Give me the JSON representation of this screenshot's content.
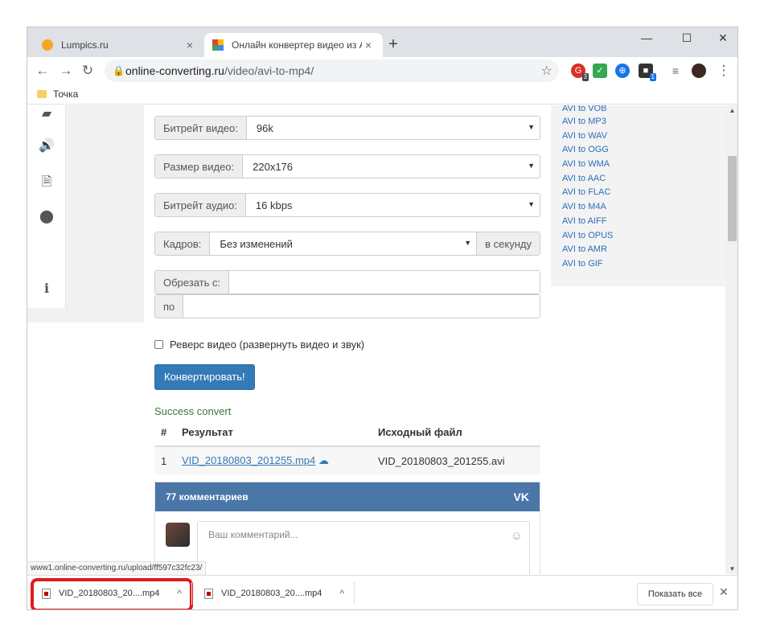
{
  "tabs": [
    {
      "title": "Lumpics.ru",
      "close": "×"
    },
    {
      "title": "Онлайн конвертер видео из AV",
      "close": "×"
    }
  ],
  "window": {
    "new_tab": "+",
    "minimize": "—",
    "maximize": "☐",
    "close": "✕"
  },
  "toolbar": {
    "back": "←",
    "forward": "→",
    "reload": "↻",
    "url_host": "online-converting.ru",
    "url_path": "/video/avi-to-mp4/",
    "ext_badges": [
      "3",
      "1"
    ],
    "menu": "⋮"
  },
  "bookmarks": [
    {
      "label": "Точка"
    }
  ],
  "form": {
    "video_bitrate_label": "Битрейт видео:",
    "video_bitrate_value": "96k",
    "video_size_label": "Размер видео:",
    "video_size_value": "220x176",
    "audio_bitrate_label": "Битрейт аудио:",
    "audio_bitrate_value": "16 kbps",
    "frames_label": "Кадров:",
    "frames_value": "Без изменений",
    "frames_suffix": "в секунду",
    "trim_from_label": "Обрезать с:",
    "trim_to_label": "по",
    "reverse_label": "Реверс видео (развернуть видео и звук)",
    "convert_button": "Конвертировать!"
  },
  "result": {
    "success_text": "Success convert",
    "headers": [
      "#",
      "Результат",
      "Исходный файл"
    ],
    "rows": [
      {
        "num": "1",
        "result": "VID_20180803_201255.mp4",
        "source": "VID_20180803_201255.avi"
      }
    ]
  },
  "comments": {
    "title": "77 комментариев",
    "logo": "VK",
    "placeholder": "Ваш комментарий..."
  },
  "sidebar_links": [
    "AVI to VOB",
    "AVI to MP3",
    "AVI to WAV",
    "AVI to OGG",
    "AVI to WMA",
    "AVI to AAC",
    "AVI to FLAC",
    "AVI to M4A",
    "AVI to AIFF",
    "AVI to OPUS",
    "AVI to AMR",
    "AVI to GIF"
  ],
  "status_url": "www1.online-converting.ru/upload/ff597c32fc23/",
  "downloads": {
    "items": [
      {
        "name": "VID_20180803_20....mp4"
      },
      {
        "name": "VID_20180803_20....mp4"
      }
    ],
    "show_all": "Показать все",
    "close": "✕"
  },
  "colors": {
    "highlight": "#e01b1b",
    "button": "#337ab7",
    "vk": "#4a76a8",
    "success": "#3c763d"
  }
}
